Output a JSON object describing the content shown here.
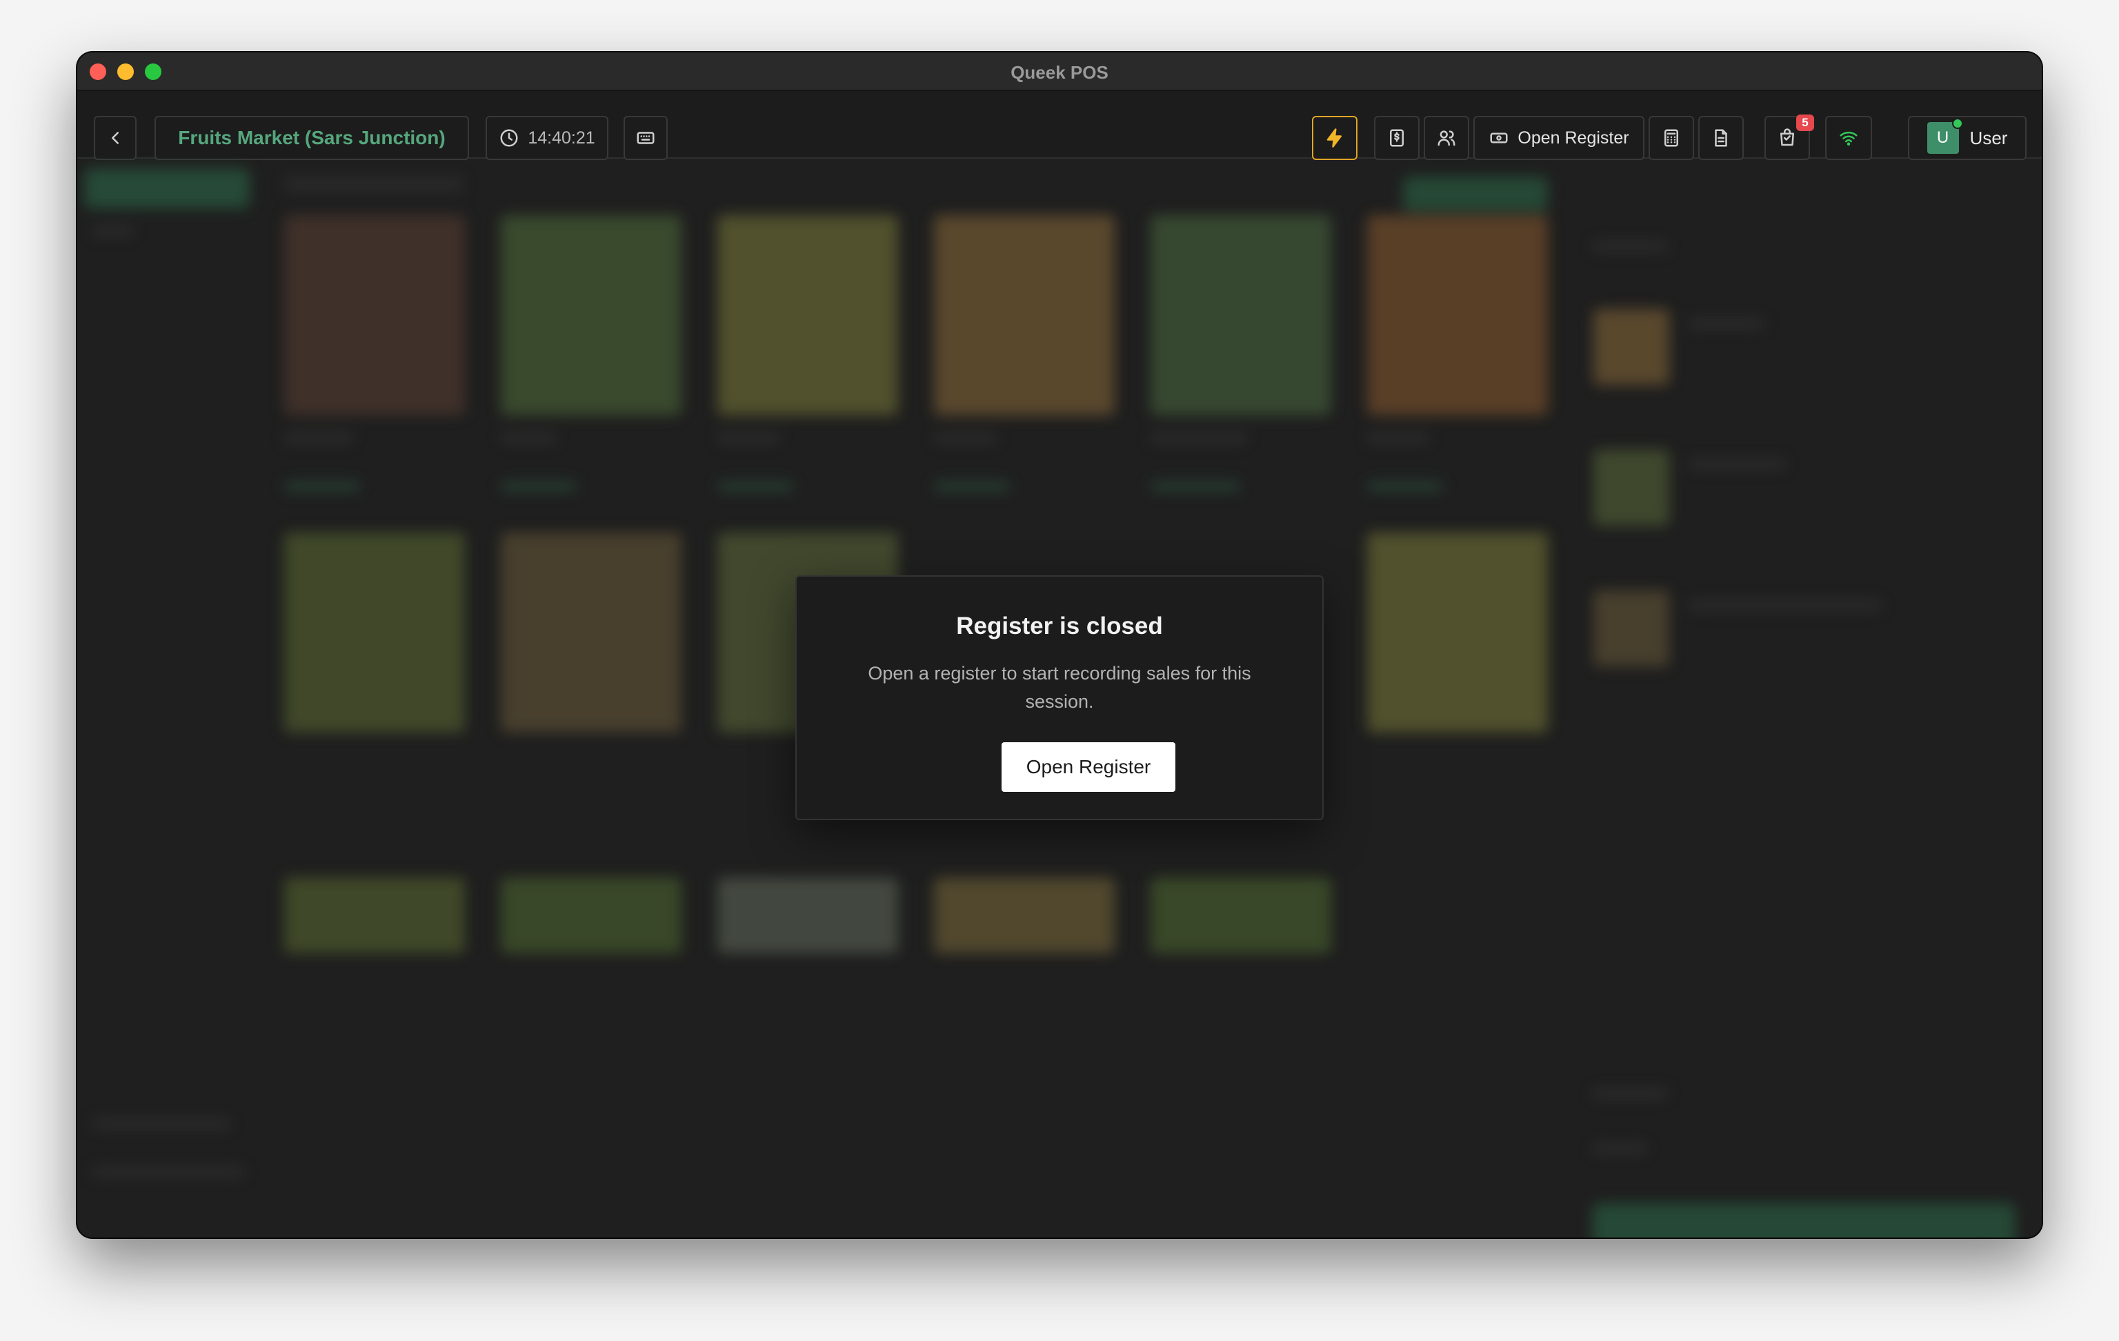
{
  "window": {
    "title": "Queek POS"
  },
  "toolbar": {
    "store_name": "Fruits Market (Sars Junction)",
    "time": "14:40:21",
    "open_register_label": "Open Register",
    "orders_badge": "5",
    "user_initial": "U",
    "user_label": "User"
  },
  "modal": {
    "title": "Register is closed",
    "description": "Open a register to start recording sales for this session.",
    "button_label": "Open Register"
  },
  "colors": {
    "accent_green": "#56a77d",
    "flash_border": "#e0a526",
    "badge_red": "#e5484d",
    "wifi_green": "#34c759"
  }
}
